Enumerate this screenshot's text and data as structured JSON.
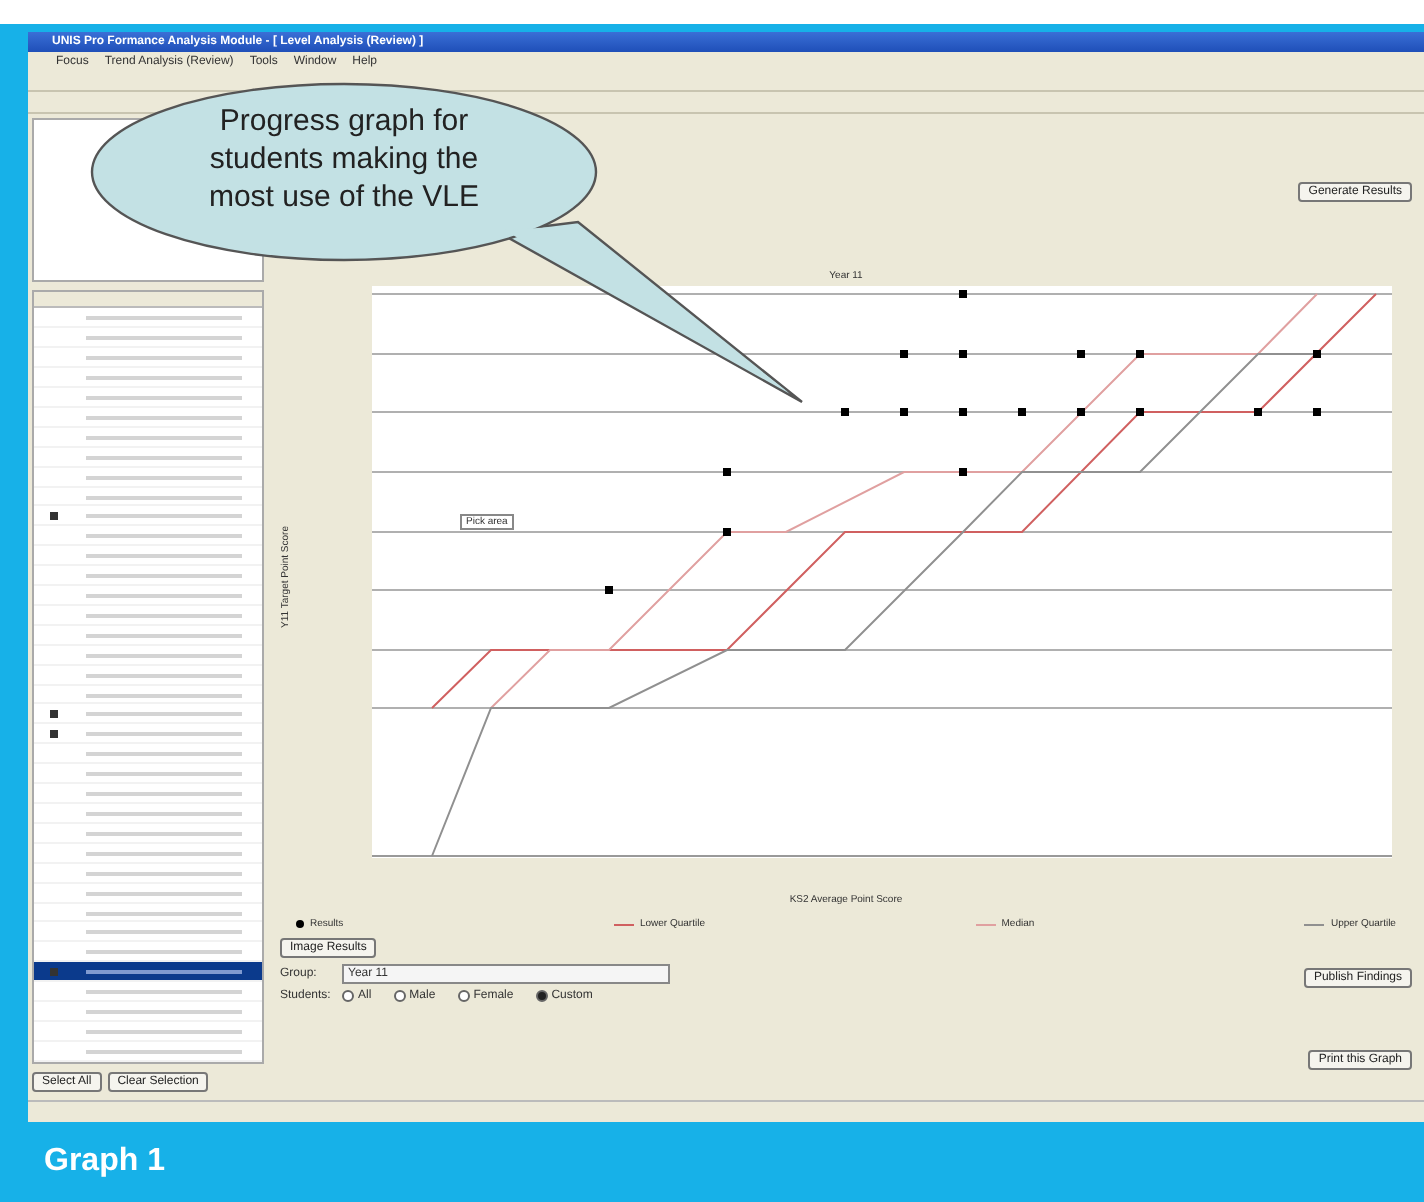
{
  "window": {
    "title": "UNIS Pro Formance Analysis Module - [ Level Analysis (Review) ]"
  },
  "menu": [
    "Focus",
    "Trend Analysis (Review)",
    "Tools",
    "Window",
    "Help"
  ],
  "student_list": {
    "rows": [
      {
        "checked": false,
        "selected": false
      },
      {
        "checked": false,
        "selected": false
      },
      {
        "checked": false,
        "selected": false
      },
      {
        "checked": false,
        "selected": false
      },
      {
        "checked": false,
        "selected": false
      },
      {
        "checked": false,
        "selected": false
      },
      {
        "checked": false,
        "selected": false
      },
      {
        "checked": false,
        "selected": false
      },
      {
        "checked": false,
        "selected": false
      },
      {
        "checked": false,
        "selected": false
      },
      {
        "checked": true,
        "selected": false
      },
      {
        "checked": false,
        "selected": false
      },
      {
        "checked": false,
        "selected": false
      },
      {
        "checked": false,
        "selected": false
      },
      {
        "checked": false,
        "selected": false
      },
      {
        "checked": false,
        "selected": false
      },
      {
        "checked": false,
        "selected": false
      },
      {
        "checked": false,
        "selected": false
      },
      {
        "checked": false,
        "selected": false
      },
      {
        "checked": false,
        "selected": false
      },
      {
        "checked": true,
        "selected": false
      },
      {
        "checked": true,
        "selected": false
      },
      {
        "checked": false,
        "selected": false
      },
      {
        "checked": false,
        "selected": false
      },
      {
        "checked": false,
        "selected": false
      },
      {
        "checked": false,
        "selected": false
      },
      {
        "checked": false,
        "selected": false
      },
      {
        "checked": false,
        "selected": false
      },
      {
        "checked": false,
        "selected": false
      },
      {
        "checked": false,
        "selected": false
      },
      {
        "checked": false,
        "selected": false
      },
      {
        "checked": false,
        "selected": false
      },
      {
        "checked": false,
        "selected": false
      },
      {
        "checked": true,
        "selected": true
      },
      {
        "checked": false,
        "selected": false
      },
      {
        "checked": false,
        "selected": false
      },
      {
        "checked": false,
        "selected": false
      },
      {
        "checked": false,
        "selected": false
      }
    ],
    "buttons": [
      "Select All",
      "Clear Selection"
    ]
  },
  "generate_button": "Generate Results",
  "chart": {
    "title": "Year 11",
    "xlabel": "KS2 Average Point Score",
    "ylabel": "Y11 Target Point Score",
    "box_label": "Pick area"
  },
  "legend": [
    {
      "kind": "dot",
      "label": "Results",
      "color": "#000000"
    },
    {
      "kind": "line",
      "label": "Lower Quartile",
      "color": "#d06060"
    },
    {
      "kind": "line",
      "label": "Median",
      "color": "#e0a0a0"
    },
    {
      "kind": "line",
      "label": "Upper Quartile",
      "color": "#909090"
    }
  ],
  "image_button": "Image Results",
  "group": {
    "label": "Group:",
    "value": "Year 11"
  },
  "students": {
    "label": "Students:",
    "options": [
      {
        "label": "All",
        "selected": false
      },
      {
        "label": "Male",
        "selected": false
      },
      {
        "label": "Female",
        "selected": false
      },
      {
        "label": "Custom",
        "selected": true
      }
    ]
  },
  "right_buttons": [
    "Publish Findings",
    "Print this Graph"
  ],
  "callout": "Progress graph for students making the most use of the VLE",
  "caption": "Graph 1"
}
